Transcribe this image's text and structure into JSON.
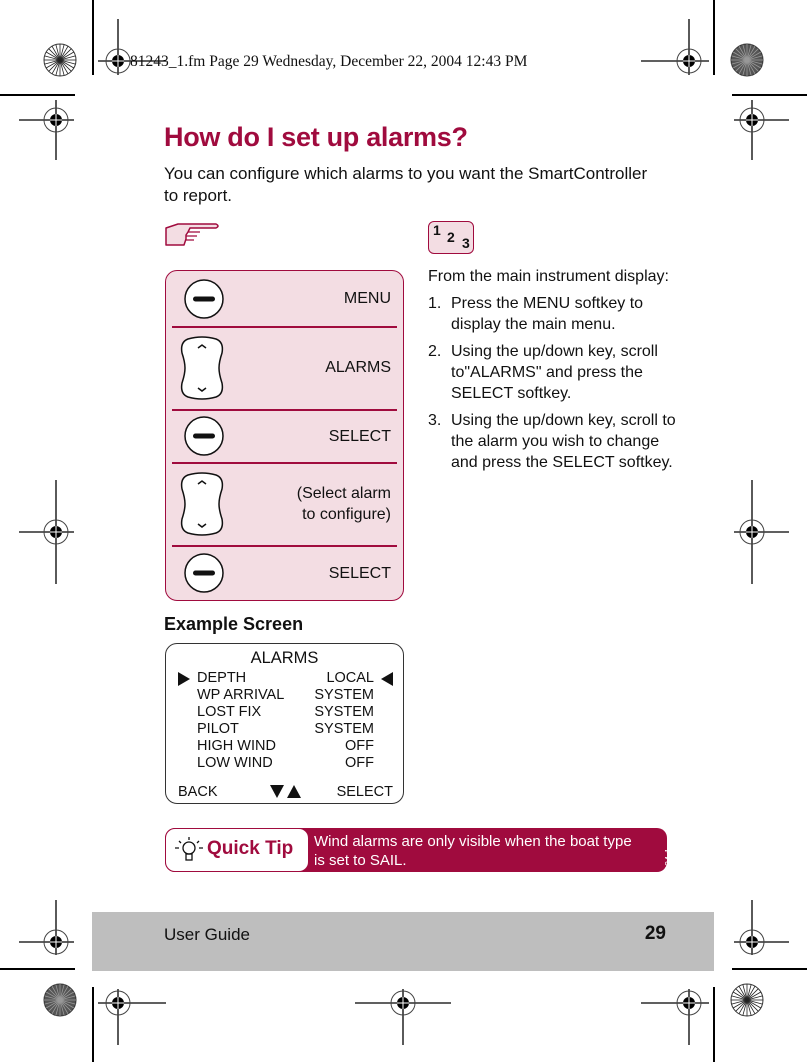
{
  "print_slug": "81243_1.fm  Page 29  Wednesday, December 22, 2004  12:43 PM",
  "page": {
    "title": "How do I set up alarms?",
    "intro": "You can configure which alarms to you want the SmartController to report.",
    "accent_color": "#a00b3e",
    "panel_fill_color": "#f3dde3"
  },
  "icons": {
    "hand": "pointing-hand-icon",
    "steps": "numbered-steps-icon",
    "steps_digits": [
      "1",
      "2",
      "3"
    ]
  },
  "keypad_sequence": [
    {
      "key": "softkey",
      "label": "MENU"
    },
    {
      "key": "up-down-key",
      "label": "ALARMS"
    },
    {
      "key": "softkey",
      "label": "SELECT"
    },
    {
      "key": "up-down-key",
      "label": "(Select alarm to configure)"
    },
    {
      "key": "softkey",
      "label": "SELECT"
    }
  ],
  "example_screen": {
    "heading": "Example Screen",
    "title": "ALARMS",
    "rows": [
      {
        "name": "DEPTH",
        "value": "LOCAL",
        "selected": true
      },
      {
        "name": "WP ARRIVAL",
        "value": "SYSTEM",
        "selected": false
      },
      {
        "name": "LOST FIX",
        "value": "SYSTEM",
        "selected": false
      },
      {
        "name": "PILOT",
        "value": "SYSTEM",
        "selected": false
      },
      {
        "name": "HIGH WIND",
        "value": "OFF",
        "selected": false
      },
      {
        "name": "LOW WIND",
        "value": "OFF",
        "selected": false
      }
    ],
    "footer": {
      "left": "BACK",
      "right": "SELECT"
    }
  },
  "instructions": {
    "lead": "From the main instrument display:",
    "steps": [
      {
        "num": "1.",
        "text": "Press the MENU softkey to display the main menu."
      },
      {
        "num": "2.",
        "text": "Using the up/down key, scroll to\"ALARMS\" and press the SELECT softkey."
      },
      {
        "num": "3.",
        "text": "Using the up/down key, scroll to the alarm you wish to change and press the SELECT softkey."
      }
    ]
  },
  "quick_tip": {
    "label": "Quick Tip",
    "text": "Wind alarms are only visible when the boat type is set to SAIL.",
    "figure_code": "D7634-1"
  },
  "footer": {
    "guide": "User Guide",
    "page_number": "29"
  }
}
